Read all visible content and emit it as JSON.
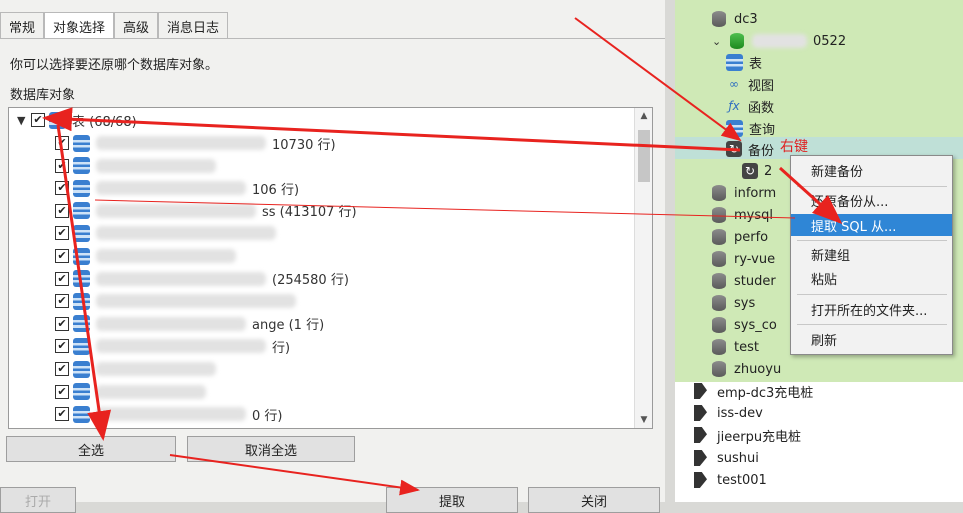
{
  "dialog": {
    "tabs": [
      "常规",
      "对象选择",
      "高级",
      "消息日志"
    ],
    "active_tab": 1,
    "hint": "你可以选择要还原哪个数据库对象。",
    "group_label": "数据库对象",
    "tree": {
      "root_label": "表 (68/68)",
      "rows": [
        {
          "suffix": "10730 行)"
        },
        {
          "suffix": ""
        },
        {
          "suffix": "106 行)"
        },
        {
          "suffix": "ss  (413107 行)"
        },
        {
          "suffix": ""
        },
        {
          "suffix": ""
        },
        {
          "suffix": "(254580 行)"
        },
        {
          "suffix": ""
        },
        {
          "suffix": "ange  (1 行)"
        },
        {
          "suffix": "行)"
        },
        {
          "suffix": ""
        },
        {
          "suffix": ""
        },
        {
          "suffix": "0 行)"
        }
      ]
    },
    "buttons": {
      "select_all": "全选",
      "deselect_all": "取消全选",
      "bottom_left": "打开",
      "extract": "提取",
      "close": "关闭"
    }
  },
  "navigator": {
    "items": [
      {
        "label": "dc3",
        "type": "db"
      },
      {
        "label": "0522",
        "type": "db-open"
      },
      {
        "label": "表",
        "type": "table"
      },
      {
        "label": "视图",
        "type": "view"
      },
      {
        "label": "函数",
        "type": "function"
      },
      {
        "label": "查询",
        "type": "query"
      },
      {
        "label": "备份",
        "type": "backup"
      },
      {
        "label": "2",
        "type": "backup-file"
      },
      {
        "label": "inform",
        "type": "db"
      },
      {
        "label": "mysql",
        "type": "db"
      },
      {
        "label": "perfo",
        "type": "db"
      },
      {
        "label": "ry-vue",
        "type": "db"
      },
      {
        "label": "studer",
        "type": "db"
      },
      {
        "label": "sys",
        "type": "db"
      },
      {
        "label": "sys_co",
        "type": "db"
      },
      {
        "label": "test",
        "type": "db"
      },
      {
        "label": "zhuoyu",
        "type": "db"
      },
      {
        "label": "emp-dc3充电桩",
        "type": "conn"
      },
      {
        "label": "iss-dev",
        "type": "conn"
      },
      {
        "label": "jieerpu充电桩",
        "type": "conn"
      },
      {
        "label": "sushui",
        "type": "conn"
      },
      {
        "label": "test001",
        "type": "conn"
      }
    ],
    "annotation": "右键"
  },
  "context_menu": {
    "items": [
      "新建备份",
      "还原备份从...",
      "提取 SQL 从...",
      "新建组",
      "粘贴",
      "打开所在的文件夹...",
      "刷新"
    ],
    "hover_index": 2
  },
  "colors": {
    "arrow": "#e8231f",
    "highlight": "#2f86d6",
    "green_bg": "#cfe9b6"
  }
}
